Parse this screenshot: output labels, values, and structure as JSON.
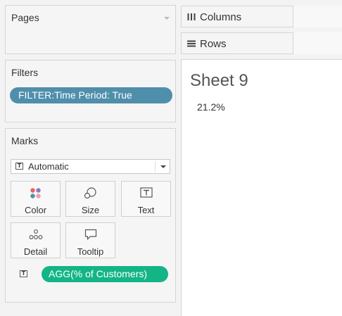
{
  "pages": {
    "title": "Pages"
  },
  "filters": {
    "title": "Filters",
    "pills": [
      "FILTER:Time Period: True"
    ]
  },
  "marks": {
    "title": "Marks",
    "mark_type": "Automatic",
    "buttons": {
      "color": "Color",
      "size": "Size",
      "text": "Text",
      "detail": "Detail",
      "tooltip": "Tooltip"
    },
    "fields": [
      {
        "encoding": "text-icon",
        "label": "AGG(% of Customers)"
      }
    ]
  },
  "shelves": {
    "columns": "Columns",
    "rows": "Rows"
  },
  "sheet": {
    "title": "Sheet 9",
    "value": "21.2%"
  },
  "colors": {
    "filter_pill": "#4f8fab",
    "measure_pill": "#13b586"
  }
}
